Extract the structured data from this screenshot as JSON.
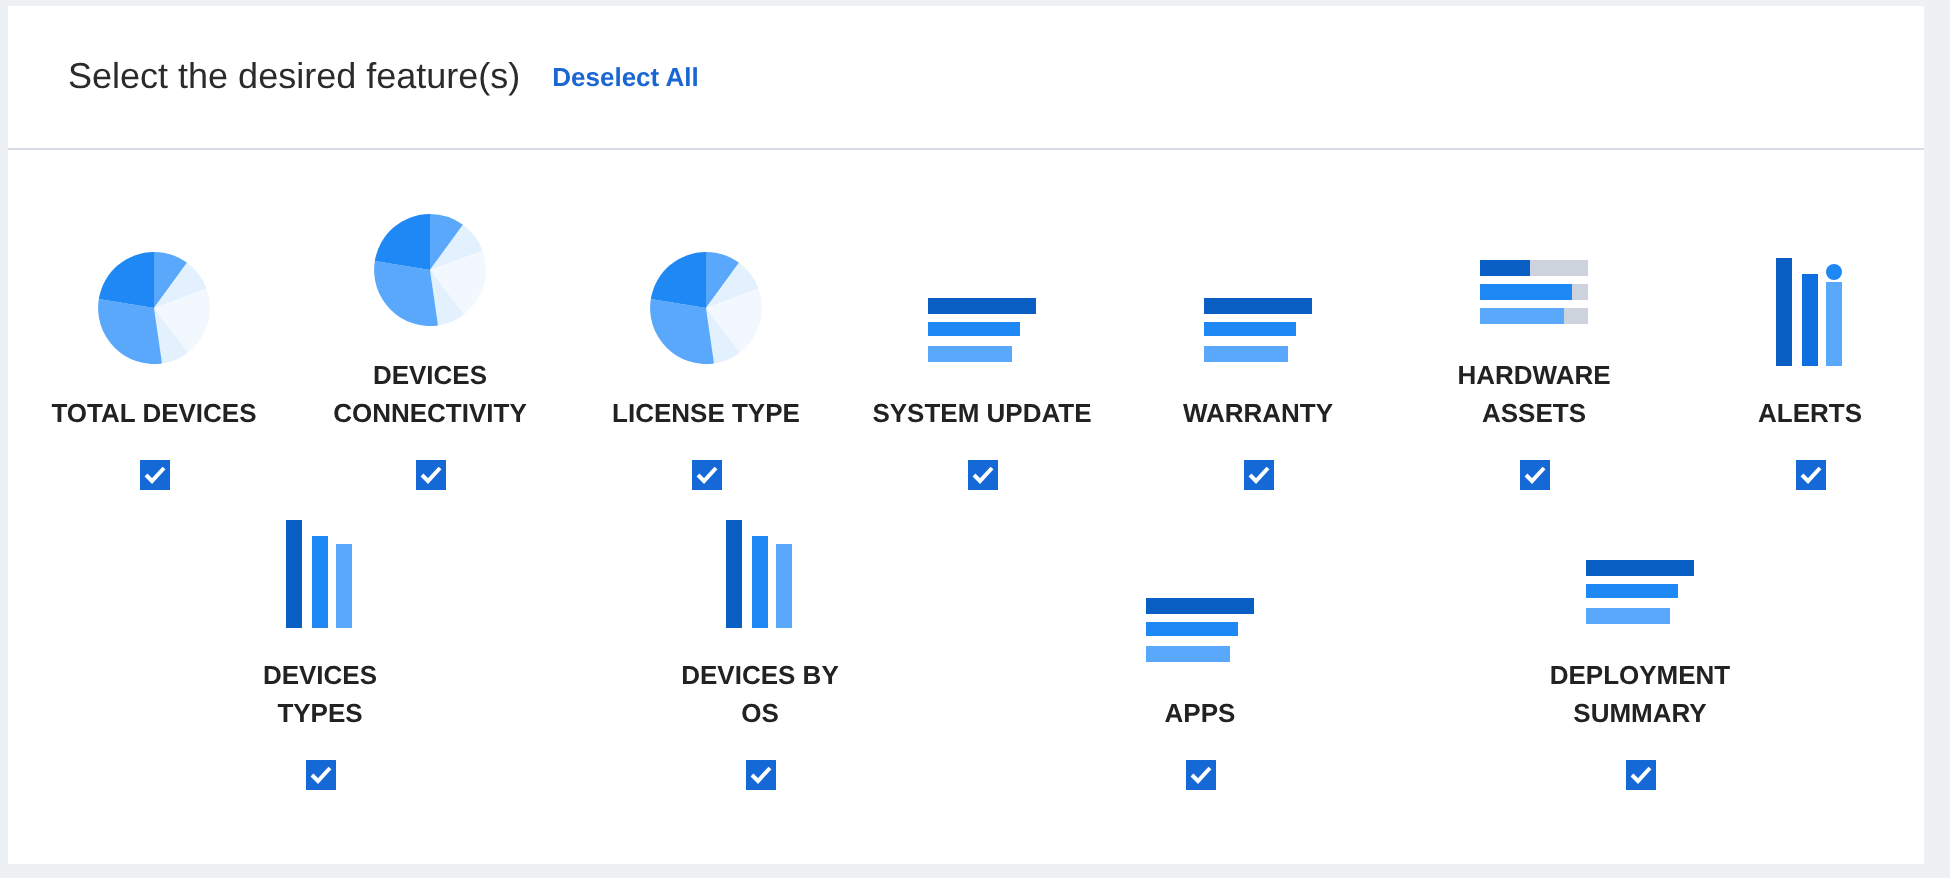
{
  "header": {
    "title": "Select the desired feature(s)",
    "action": "Deselect All"
  },
  "rows": [
    [
      {
        "kind": "pie",
        "label": "TOTAL DEVICES",
        "checked": true
      },
      {
        "kind": "pie",
        "label": "DEVICES CONNECTIVITY",
        "checked": true
      },
      {
        "kind": "pie",
        "label": "LICENSE TYPE",
        "checked": true
      },
      {
        "kind": "hbars",
        "label": "SYSTEM UPDATE",
        "checked": true
      },
      {
        "kind": "hbars",
        "label": "WARRANTY",
        "checked": true
      },
      {
        "kind": "progress",
        "label": "HARDWARE ASSETS",
        "checked": true
      },
      {
        "kind": "alerts",
        "label": "ALERTS",
        "checked": true
      }
    ],
    [
      {
        "kind": "vbars",
        "label": "DEVICES TYPES",
        "checked": true
      },
      {
        "kind": "vbars",
        "label": "DEVICES BY OS",
        "checked": true
      },
      {
        "kind": "hbars",
        "label": "APPS",
        "checked": true
      },
      {
        "kind": "hbars",
        "label": "DEPLOYMENT SUMMARY",
        "checked": true
      }
    ]
  ]
}
